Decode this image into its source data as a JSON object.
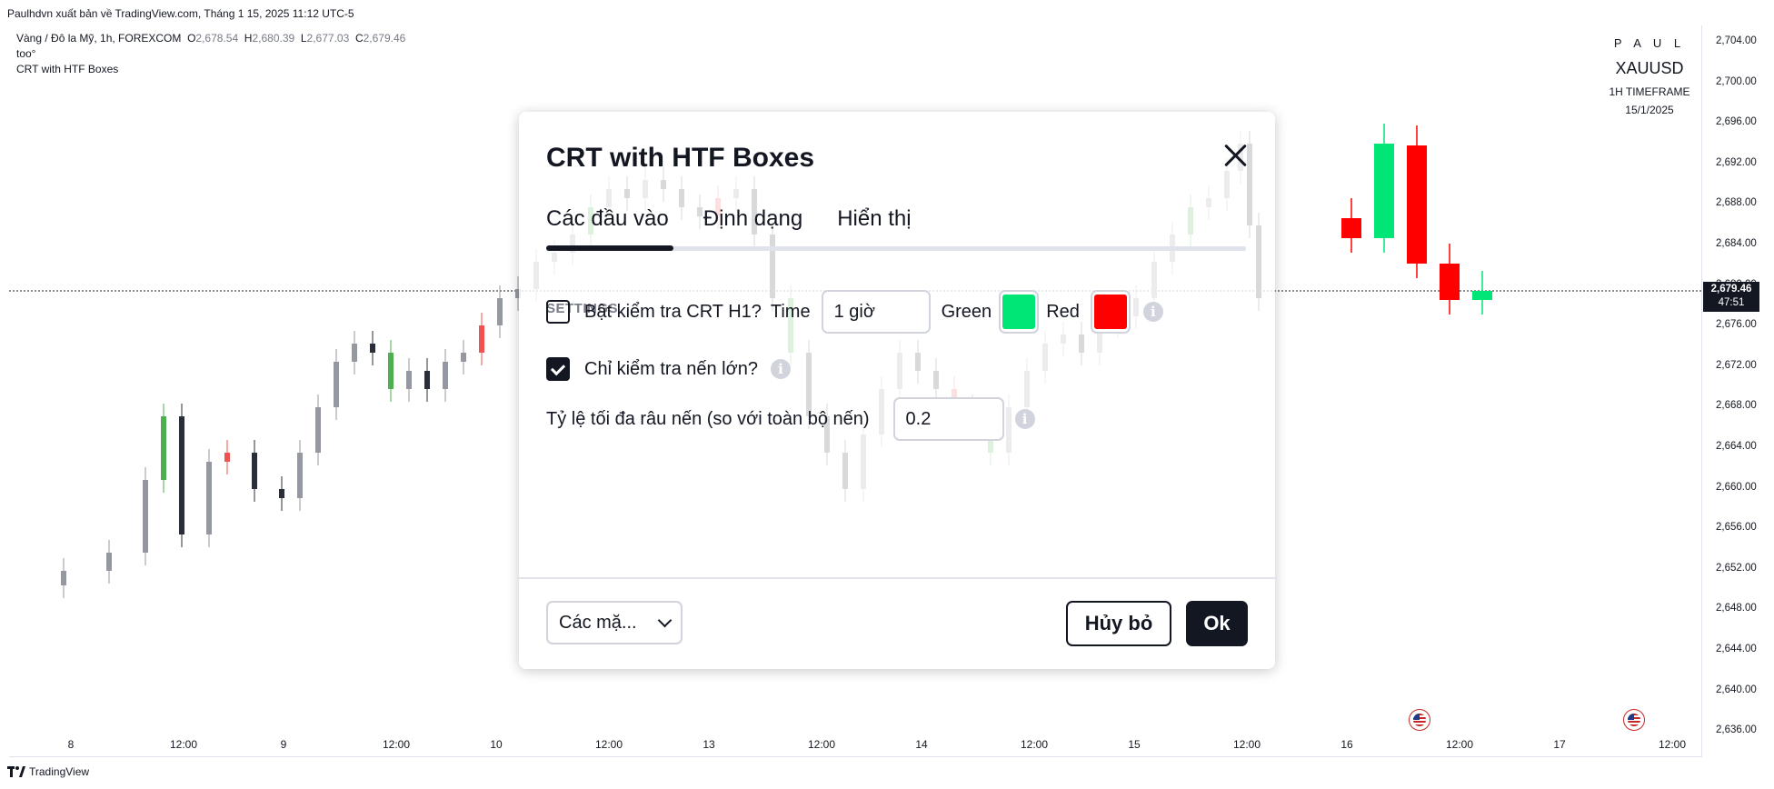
{
  "header": {
    "publisher_line": "Paulhdvn xuất bản về TradingView.com, Tháng 1 15, 2025 11:12 UTC-5"
  },
  "legend": {
    "symbol_desc": "Vàng / Đô la Mỹ, 1h, FOREXCOM",
    "o_label": "O",
    "o_value": "2,678.54",
    "h_label": "H",
    "h_value": "2,680.39",
    "l_label": "L",
    "l_value": "2,677.03",
    "c_label": "C",
    "c_value": "2,679.46",
    "line2": "too°",
    "line3": "CRT with HTF Boxes"
  },
  "watermark": {
    "name": "P A U L",
    "symbol": "XAUUSD",
    "timeframe": "1H TIMEFRAME",
    "date": "15/1/2025"
  },
  "price_scale": {
    "ticks": [
      "2,704.00",
      "2,700.00",
      "2,696.00",
      "2,692.00",
      "2,688.00",
      "2,684.00",
      "2,680.00",
      "2,676.00",
      "2,672.00",
      "2,668.00",
      "2,664.00",
      "2,660.00",
      "2,656.00",
      "2,652.00",
      "2,648.00",
      "2,644.00",
      "2,640.00",
      "2,636.00"
    ],
    "last_price": "2,679.46",
    "countdown": "47:51"
  },
  "time_scale": {
    "ticks": [
      "8",
      "12:00",
      "9",
      "12:00",
      "10",
      "12:00",
      "13",
      "12:00",
      "14",
      "12:00",
      "15",
      "12:00",
      "16",
      "12:00",
      "17",
      "12:00"
    ]
  },
  "footer": {
    "brand": "TradingView"
  },
  "dialog": {
    "title": "CRT with HTF Boxes",
    "tabs": [
      "Các đầu vào",
      "Định dạng",
      "Hiển thị"
    ],
    "section": "SETTINGS",
    "row1": {
      "checkbox_label": "Bật kiểm tra CRT H1?",
      "time_label": "Time",
      "time_value": "1 giờ",
      "green_label": "Green",
      "green_color": "#00e676",
      "red_label": "Red",
      "red_color": "#ff0000"
    },
    "row2": {
      "checkbox_label": "Chỉ kiểm tra nến lớn?"
    },
    "row3": {
      "label": "Tỷ lệ tối đa râu nến (so với toàn bộ nến)",
      "value": "0.2"
    },
    "preset_label": "Các mặ...",
    "cancel_label": "Hủy bỏ",
    "ok_label": "Ok",
    "info_glyph": "i"
  },
  "colors": {
    "bull": "#9598a1",
    "bear": "#2a2e39",
    "accent_green": "#4caf50",
    "accent_red": "#ef5350",
    "htf_green": "#00e676",
    "htf_red": "#ff0000"
  }
}
